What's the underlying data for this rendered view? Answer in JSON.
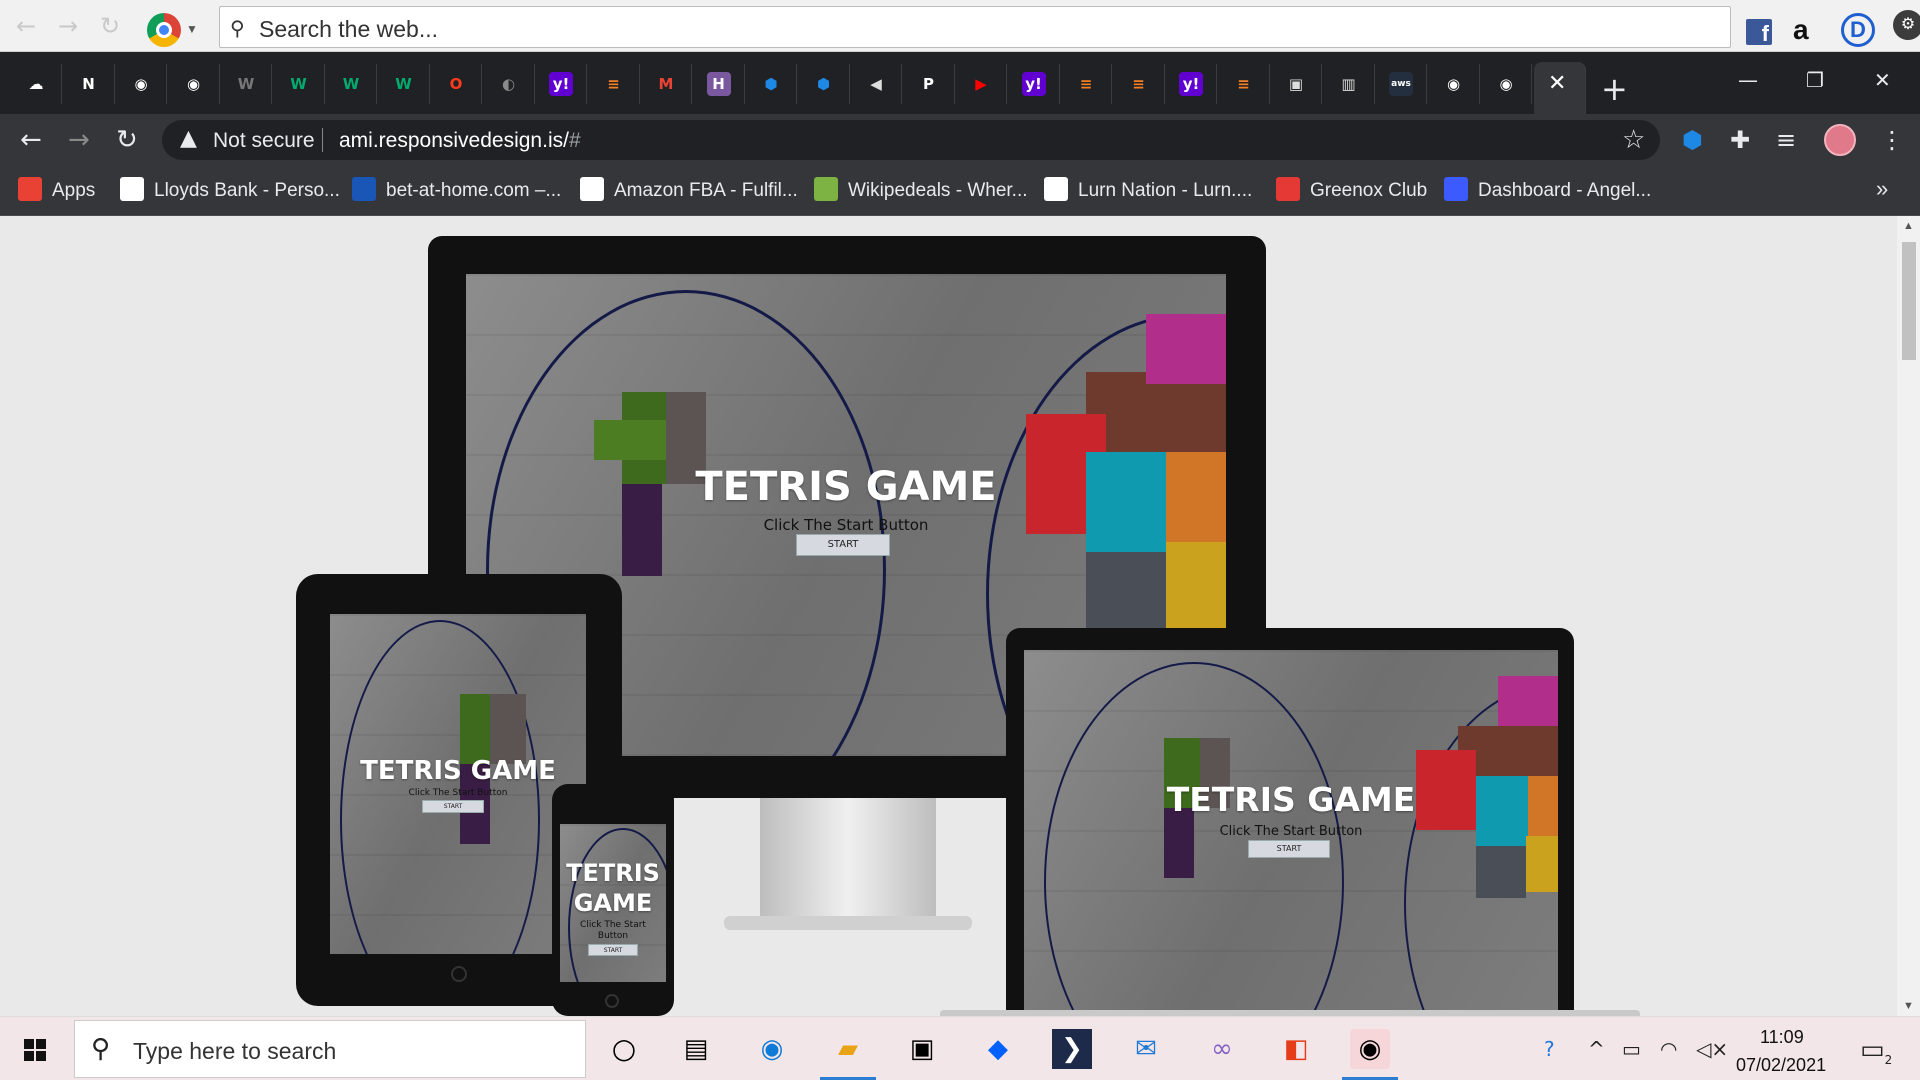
{
  "outer_toolbar": {
    "search_placeholder": "Search the web...",
    "amazon_letter": "a",
    "d_letter": "D"
  },
  "tabs": [
    {
      "icon": "cloud-icon",
      "color": "#ffffff",
      "glyph": "☁"
    },
    {
      "icon": "notion-icon",
      "color": "#ffffff",
      "glyph": "N"
    },
    {
      "icon": "github-icon",
      "color": "#ffffff",
      "glyph": "◉"
    },
    {
      "icon": "github-icon",
      "color": "#ffffff",
      "glyph": "◉"
    },
    {
      "icon": "w3schools-icon",
      "color": "#777777",
      "glyph": "W"
    },
    {
      "icon": "w3schools-icon",
      "color": "#04aa6d",
      "glyph": "W"
    },
    {
      "icon": "w3schools-icon",
      "color": "#04aa6d",
      "glyph": "W"
    },
    {
      "icon": "w3schools-icon",
      "color": "#04aa6d",
      "glyph": "W"
    },
    {
      "icon": "opera-icon",
      "color": "#ff3b1f",
      "glyph": "O"
    },
    {
      "icon": "globe-icon",
      "color": "#8a8a8a",
      "glyph": "◐"
    },
    {
      "icon": "yahoo-icon",
      "color": "#6001d2",
      "glyph": "y!"
    },
    {
      "icon": "stackoverflow-icon",
      "color": "#f48024",
      "glyph": "≡"
    },
    {
      "icon": "gmail-icon",
      "color": "#ea4335",
      "glyph": "M"
    },
    {
      "icon": "heroku-icon",
      "color": "#79589f",
      "glyph": "H"
    },
    {
      "icon": "cube-icon",
      "color": "#1e88e5",
      "glyph": "⬢"
    },
    {
      "icon": "cube-icon",
      "color": "#1e88e5",
      "glyph": "⬢"
    },
    {
      "icon": "speaker-icon",
      "color": "#dddddd",
      "glyph": "◀"
    },
    {
      "icon": "pinterest-icon",
      "color": "#ffffff",
      "glyph": "P"
    },
    {
      "icon": "youtube-icon",
      "color": "#ff0000",
      "glyph": "▶"
    },
    {
      "icon": "yahoo-icon",
      "color": "#6001d2",
      "glyph": "y!"
    },
    {
      "icon": "stackoverflow-icon",
      "color": "#f48024",
      "glyph": "≡"
    },
    {
      "icon": "stackoverflow-icon",
      "color": "#f48024",
      "glyph": "≡"
    },
    {
      "icon": "yahoo-icon",
      "color": "#6001d2",
      "glyph": "y!"
    },
    {
      "icon": "stackoverflow-icon",
      "color": "#f48024",
      "glyph": "≡"
    },
    {
      "icon": "document-icon",
      "color": "#dddddd",
      "glyph": "▣"
    },
    {
      "icon": "columns-icon",
      "color": "#dddddd",
      "glyph": "▥"
    },
    {
      "icon": "aws-icon",
      "color": "#232f3e",
      "glyph": "aws"
    },
    {
      "icon": "github-icon",
      "color": "#ffffff",
      "glyph": "◉"
    },
    {
      "icon": "github-icon",
      "color": "#ffffff",
      "glyph": "◉"
    }
  ],
  "address_bar": {
    "security_label": "Not secure",
    "url_host": "ami.responsivedesign.is/",
    "url_hash": "#"
  },
  "bookmarks": [
    {
      "label": "Apps",
      "icon": "apps-grid-icon",
      "color": "#e94235"
    },
    {
      "label": "Lloyds Bank - Perso...",
      "icon": "lloyds-horse-icon",
      "color": "#ffffff"
    },
    {
      "label": "bet-at-home.com –...",
      "icon": "bet-at-home-icon",
      "color": "#1a56b5"
    },
    {
      "label": "Amazon FBA - Fulfil...",
      "icon": "amazon-icon",
      "color": "#ffffff"
    },
    {
      "label": "Wikipedeals - Wher...",
      "icon": "wikipedeals-icon",
      "color": "#7cb342"
    },
    {
      "label": "Lurn Nation - Lurn....",
      "icon": "lurn-icon",
      "color": "#ffffff"
    },
    {
      "label": "Greenox Club",
      "icon": "power-icon",
      "color": "#e53935"
    },
    {
      "label": "Dashboard - Angel...",
      "icon": "angel-icon",
      "color": "#3d5afe"
    }
  ],
  "devices": {
    "title": "TETRIS GAME",
    "subtitle": "Click The Start Button",
    "start_label": "START",
    "phone_title_line1": "TETRIS",
    "phone_title_line2": "GAME"
  },
  "taskbar": {
    "search_placeholder": "Type here to search",
    "time": "11:09",
    "date": "07/02/2021",
    "notification_count": "2"
  }
}
